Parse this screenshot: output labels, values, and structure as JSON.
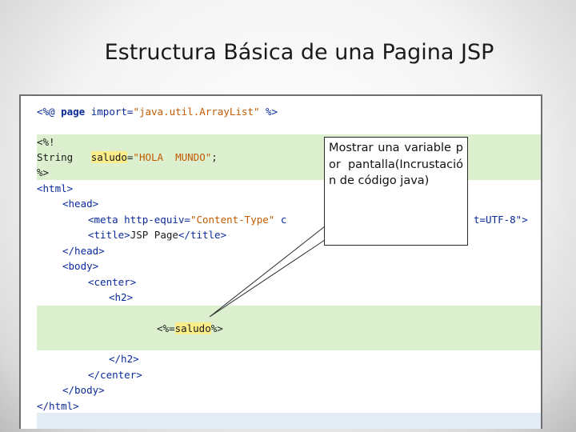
{
  "slide": {
    "title": "Estructura Básica de una Pagina JSP"
  },
  "code": {
    "line1": {
      "open": "<%@ ",
      "kw": "page",
      "attr": " import=",
      "val": "\"java.util.ArrayList\"",
      "close": " %>"
    },
    "line2": "<%!",
    "line3": {
      "type": "String   ",
      "var": "saludo",
      "eq": "=",
      "val": "\"HOLA  MUNDO\"",
      "end": ";"
    },
    "line4": "%>",
    "line5": "<html>",
    "line6": "<head>",
    "line7": {
      "start": "<meta http-equiv=",
      "val": "\"Content-Type\"",
      "rest": " c",
      "tail": "t=UTF-8\">"
    },
    "line8": {
      "open": "<title>",
      "text": "JSP Page",
      "close": "</title>"
    },
    "line9": "</head>",
    "line10": "<body>",
    "line11": "<center>",
    "line12": "<h2>",
    "line13": {
      "open": "<%=",
      "var": "saludo",
      "close": "%>"
    },
    "line14": "</h2>",
    "line15": "</center>",
    "line16": "</body>",
    "line17": "</html>"
  },
  "callout": {
    "text": "Mostrar una variable por pantalla(Incrustación de código java)"
  },
  "colors": {
    "keyword": "#0a2a9a",
    "string": "#c25b00",
    "band": "#dcefcf",
    "highlight": "#fbee8a"
  }
}
